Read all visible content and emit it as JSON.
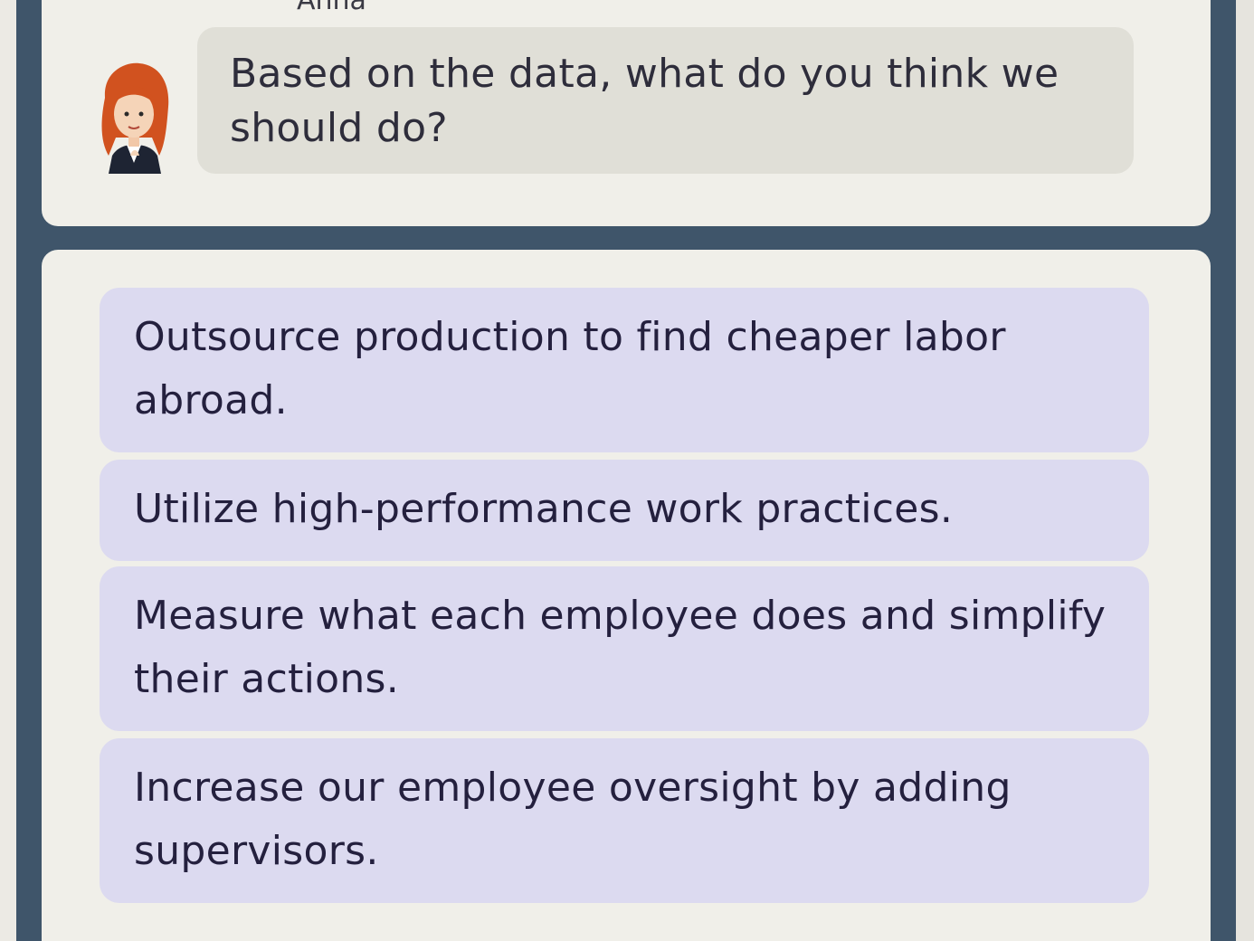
{
  "speaker": {
    "name": "Anna"
  },
  "message": {
    "text": "Based on the data, what do you think we should do?"
  },
  "options": [
    {
      "label": "Outsource production to find cheaper labor abroad."
    },
    {
      "label": "Utilize high-performance work practices."
    },
    {
      "label": "Measure what each employee does and simplify their actions."
    },
    {
      "label": "Increase our employee oversight by adding supervisors."
    }
  ],
  "colors": {
    "frame": "#3f556a",
    "card": "#f0efe9",
    "bubble": "#e0dfd7",
    "option": "#dcdaf0",
    "text": "#24203e",
    "hair": "#d1521f"
  }
}
